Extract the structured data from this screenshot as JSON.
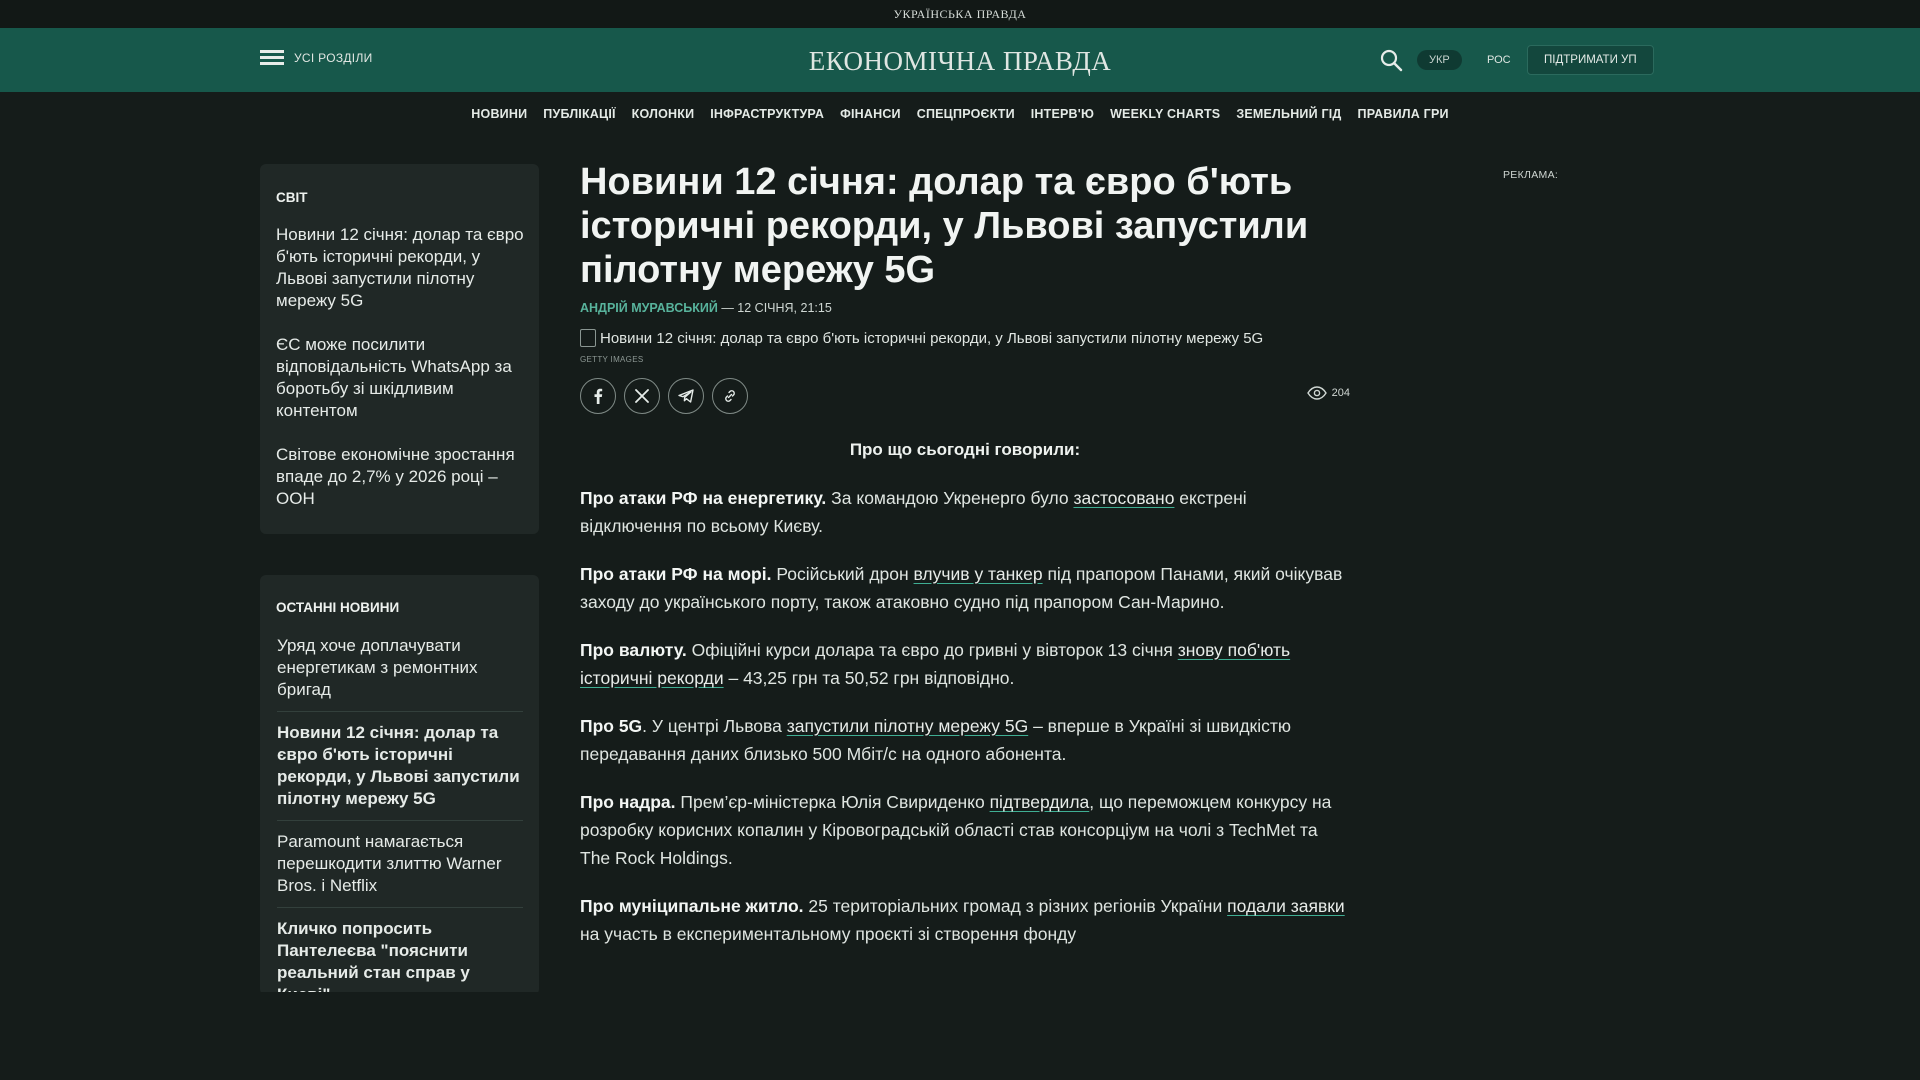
{
  "topbar": {
    "brand": "УКРАЇНСЬКА ПРАВДА"
  },
  "header": {
    "menu_label": "УСІ РОЗДІЛИ",
    "logo": "ЕКОНОМІЧНА ПРАВДА",
    "lang_ukr": "УКР",
    "lang_ros": "РОС",
    "support": "ПІДТРИМАТИ УП",
    "search_icon": "search-icon"
  },
  "nav": {
    "items": [
      "НОВИНИ",
      "ПУБЛІКАЦІЇ",
      "КОЛОНКИ",
      "ІНФРАСТРУКТУРА",
      "ФІНАНСИ",
      "СПЕЦПРОЄКТИ",
      "ІНТЕРВ'Ю",
      "WEEKLY CHARTS",
      "ЗЕМЕЛЬНИЙ ГІД",
      "ПРАВИЛА ГРИ"
    ]
  },
  "sidebar": {
    "world": {
      "title": "СВІТ",
      "items": [
        "Новини 12 січня: долар та євро б'ють історичні рекорди, у Львові запустили пілотну мережу 5G",
        "ЄС може посилити відповідальність WhatsApp за боротьбу зі шкідливим контентом",
        "Світове економічне зростання впаде до 2,7% у 2026 році – ООН"
      ]
    },
    "latest": {
      "title": "ОСТАННІ НОВИНИ",
      "items": [
        "Уряд хоче доплачувати енергетикам з ремонтних бригад",
        "Новини 12 січня: долар та євро б'ють історичні рекорди, у Львові запустили пілотну мережу 5G",
        "Paramount намагається перешкодити злиттю Warner Bros. і Netflix",
        "Кличко попросить Пантелеєва \"пояснити реальний стан справ у Києві\""
      ]
    }
  },
  "article": {
    "title": "Новини 12 січня: долар та євро б'ють історичні рекорди, у Львові запустили пілотну мережу 5G",
    "author": "АНДРІЙ МУРАВСЬКИЙ",
    "date": " — 12 СІЧНЯ, 21:15",
    "image_alt": "Новини 12 січня: долар та євро б'ють історичні рекорди, у Львові запустили пілотну мережу 5G",
    "image_credit": "GETTY IMAGES",
    "views": "204",
    "intro": "Про що сьогодні говорили:",
    "p1": {
      "lead": "Про атаки РФ на енергетику.",
      "t1": " За командою Укренерго було ",
      "link": "застосовано",
      "t2": " екстрені відключення по всьому Києву."
    },
    "p2": {
      "lead": "Про атаки РФ на морі.",
      "t1": " Російський дрон ",
      "link": "влучив у танкер",
      "t2": " під прапором Панами, який очікував заходу до українського порту, також атаковно судно під прапором Сан-Марино."
    },
    "p3": {
      "lead": "Про валюту.",
      "t1": " Офіційні курси долара та євро до гривні у вівторок 13 січня ",
      "link": "знову поб'ють історичні рекорди",
      "t2": " – 43,25 грн та 50,52 грн відповідно."
    },
    "p4": {
      "lead": "Про 5G",
      "t1": ". У центрі Львова ",
      "link": "запустили пілотну мережу 5G",
      "t2": " – вперше в Україні зі швидкістю передавання даних близько 500 Мбіт/с на одного абонента."
    },
    "p5": {
      "lead": "Про надра.",
      "t1": " Прем’єр-міністерка Юлія Свириденко ",
      "link": "підтвердила",
      "t2": ", що переможцем конкурсу на розробку корисних копалин у Кіровоградській області став консорціум на чолі з TechMet та The Rock Holdings."
    },
    "p6": {
      "lead": "Про муніципальне житло.",
      "t1": " 25 територіальних громад з різних регіонів України ",
      "link": "подали заявки",
      "t2": " на участь в експериментальному проєкті зі створення фонду"
    }
  },
  "ads": {
    "label": "РЕКЛАМА:"
  },
  "colors": {
    "header_green": "#17584b",
    "accent": "#58b39c",
    "background": "#151c1a"
  }
}
